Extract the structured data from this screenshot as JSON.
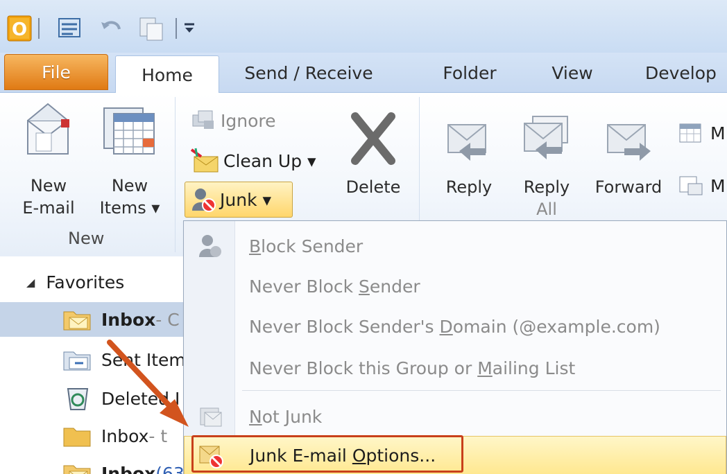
{
  "tabs": [
    "File",
    "Home",
    "Send / Receive",
    "Folder",
    "View",
    "Develop"
  ],
  "ribbon": {
    "new_email": [
      "New",
      "E-mail"
    ],
    "new_items": [
      "New",
      "Items ▾"
    ],
    "group_new": "New",
    "ignore": "Ignore",
    "clean_up": "Clean Up ▾",
    "junk": "Junk ▾",
    "delete": "Delete",
    "reply": "Reply",
    "reply_all": [
      "Reply",
      "All"
    ],
    "forward": "Forward",
    "more1": "M",
    "more2": "M"
  },
  "nav": {
    "favorites": "Favorites",
    "items": [
      {
        "label": "Inbox",
        "suffix": " - C"
      },
      {
        "label": "Sent Item"
      },
      {
        "label": "Deleted I"
      },
      {
        "label": "Inbox",
        "suffix": " - t"
      },
      {
        "label": "Inbox",
        "suffix": " (63"
      }
    ]
  },
  "menu": {
    "block_sender": {
      "u": "B",
      "rest": "lock Sender"
    },
    "never_block_sender": {
      "pre": "Never Block ",
      "u": "S",
      "rest": "ender"
    },
    "never_block_domain": {
      "pre": "Never Block Sender's ",
      "u": "D",
      "rest": "omain (@example.com)"
    },
    "never_block_group": {
      "pre": "Never Block this Group or ",
      "u": "M",
      "rest": "ailing List"
    },
    "not_junk": {
      "u": "N",
      "rest": "ot Junk"
    },
    "junk_options": {
      "pre": "Junk E-mail ",
      "u": "O",
      "rest": "ptions..."
    }
  },
  "colors": {
    "file_tab": "#e07a14",
    "highlight": "#ffe890",
    "callout": "#c8401a"
  }
}
